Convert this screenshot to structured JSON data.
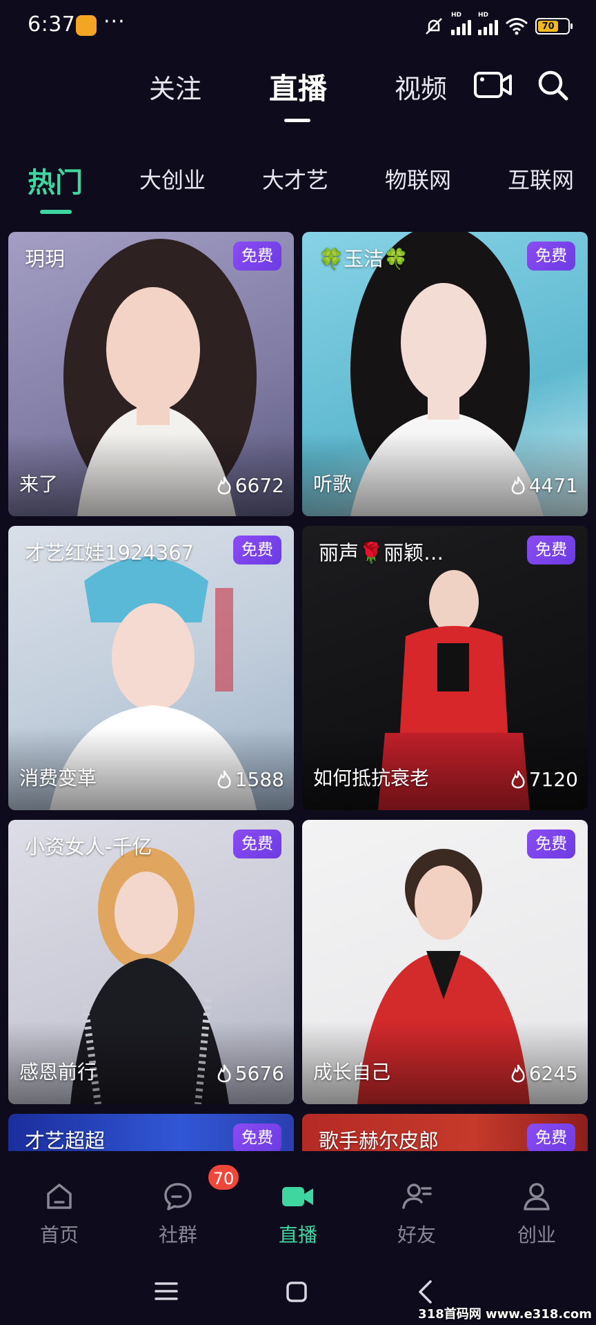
{
  "status": {
    "time": "6:37",
    "more": "···",
    "battery": "70",
    "net1": "HD",
    "net2": "HD"
  },
  "top_tabs": [
    {
      "label": "关注"
    },
    {
      "label": "直播",
      "active": true
    },
    {
      "label": "视频"
    }
  ],
  "categories": [
    {
      "label": "热门",
      "active": true
    },
    {
      "label": "大创业"
    },
    {
      "label": "大才艺"
    },
    {
      "label": "物联网"
    },
    {
      "label": "互联网"
    }
  ],
  "streams": [
    {
      "title": "玥玥",
      "badge": "免费",
      "caption": "来了",
      "views": "6672"
    },
    {
      "title": "🍀玉洁🍀",
      "badge": "免费",
      "caption": "听歌",
      "views": "4471"
    },
    {
      "title": "才艺红娃1924367",
      "badge": "免费",
      "caption": "消费变革",
      "views": "1588"
    },
    {
      "title": "丽声🌹丽颖…",
      "badge": "免费",
      "caption": "如何抵抗衰老",
      "views": "7120"
    },
    {
      "title": "小资女人-千亿",
      "badge": "免费",
      "caption": "感恩前行",
      "views": "5676"
    },
    {
      "title": "",
      "badge": "免费",
      "caption": "成长自己",
      "views": "6245"
    },
    {
      "title": "才艺超超",
      "badge": "免费"
    },
    {
      "title": "歌手赫尔皮郎",
      "badge": "免费"
    }
  ],
  "bottom_nav": [
    {
      "label": "首页",
      "icon": "home-icon"
    },
    {
      "label": "社群",
      "icon": "chat-icon",
      "badge": "70"
    },
    {
      "label": "直播",
      "icon": "video-camera-icon",
      "active": true
    },
    {
      "label": "好友",
      "icon": "friends-icon"
    },
    {
      "label": "创业",
      "icon": "user-icon"
    }
  ],
  "watermark": "318首码网 www.e318.com",
  "colors": {
    "background": "#0e0b1c",
    "accent": "#3fd6a0",
    "badge": "#7a45ea",
    "notification": "#f0473b"
  }
}
